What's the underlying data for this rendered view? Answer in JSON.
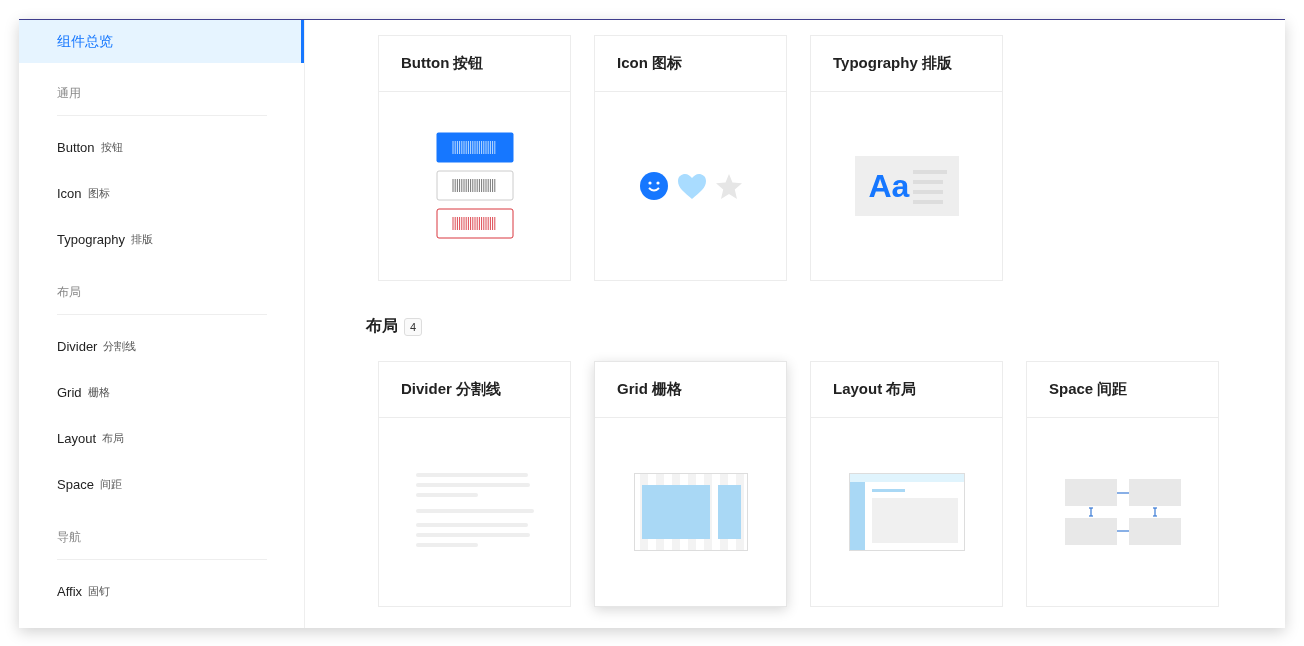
{
  "sidebar": {
    "items": [
      {
        "kind": "item",
        "label": "组件总览",
        "selected": true
      },
      {
        "kind": "group",
        "label": "通用"
      },
      {
        "kind": "item",
        "label": "Button",
        "sub": "按钮",
        "selected": false
      },
      {
        "kind": "item",
        "label": "Icon",
        "sub": "图标",
        "selected": false
      },
      {
        "kind": "item",
        "label": "Typography",
        "sub": "排版",
        "selected": false
      },
      {
        "kind": "group",
        "label": "布局"
      },
      {
        "kind": "item",
        "label": "Divider",
        "sub": "分割线",
        "selected": false
      },
      {
        "kind": "item",
        "label": "Grid",
        "sub": "栅格",
        "selected": false
      },
      {
        "kind": "item",
        "label": "Layout",
        "sub": "布局",
        "selected": false
      },
      {
        "kind": "item",
        "label": "Space",
        "sub": "间距",
        "selected": false
      },
      {
        "kind": "group",
        "label": "导航"
      },
      {
        "kind": "item",
        "label": "Affix",
        "sub": "固钉",
        "selected": false
      }
    ]
  },
  "sections": [
    {
      "cards": [
        {
          "title": "Button 按钮",
          "kind": "button",
          "hovered": false
        },
        {
          "title": "Icon 图标",
          "kind": "icon",
          "hovered": false
        },
        {
          "title": "Typography 排版",
          "kind": "typography",
          "sample": "Aa",
          "hovered": false
        }
      ]
    },
    {
      "title": "布局",
      "count": "4",
      "cards": [
        {
          "title": "Divider 分割线",
          "kind": "divider",
          "hovered": false
        },
        {
          "title": "Grid 栅格",
          "kind": "grid",
          "hovered": true
        },
        {
          "title": "Layout 布局",
          "kind": "layout",
          "hovered": false
        },
        {
          "title": "Space 间距",
          "kind": "space",
          "hovered": false
        }
      ]
    }
  ]
}
